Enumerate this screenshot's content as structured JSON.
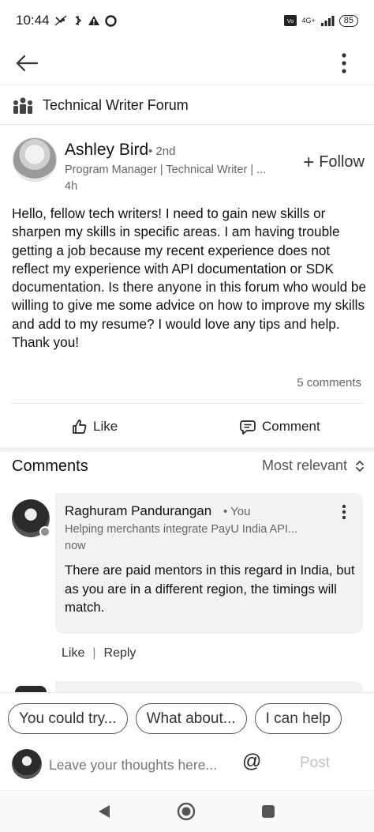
{
  "status_bar": {
    "time": "10:44",
    "network": "4G+",
    "battery": "85"
  },
  "group": {
    "name": "Technical Writer Forum"
  },
  "post": {
    "author_name": "Ashley Bird",
    "author_degree": "• 2nd",
    "author_headline": "Program Manager | Technical Writer | ...",
    "time": "4h",
    "follow_label": "Follow",
    "body": "Hello, fellow tech writers! I need to gain new skills or sharpen my skills in specific areas. I am having trouble getting a job because my recent experience does not reflect my experience with API documentation or SDK documentation.  Is there anyone in this forum who would be willing to give me some advice on how to improve my skills and add to my resume? I would love any tips and help. Thank you!",
    "comments_count": "5 comments",
    "like_label": "Like",
    "comment_label": "Comment"
  },
  "comments_section": {
    "title": "Comments",
    "sort_label": "Most relevant",
    "items": [
      {
        "name": "Raghuram Pandurangan",
        "you_label": "• You",
        "headline": "Helping merchants integrate PayU India API...",
        "time": "now",
        "text": "There are paid mentors in this regard in India, but as you are in a different region, the timings will match.",
        "like_label": "Like",
        "reply_label": "Reply"
      }
    ]
  },
  "composer": {
    "suggestions": [
      "You could try...",
      "What about...",
      "I can help"
    ],
    "placeholder": "Leave your thoughts here...",
    "mention_symbol": "@",
    "post_label": "Post"
  },
  "colors": {
    "text_primary": "#111111",
    "text_secondary": "#666666",
    "comment_bg": "#f2f2f2",
    "post_disabled": "#c2c2c2"
  }
}
